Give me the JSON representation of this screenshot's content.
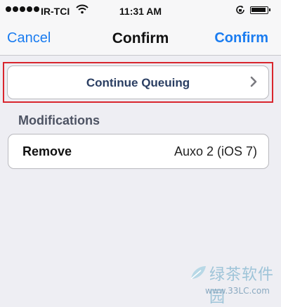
{
  "status_bar": {
    "carrier": "IR-TCI",
    "time": "11:31 AM",
    "signal_bars_filled": 5
  },
  "navbar": {
    "left_label": "Cancel",
    "title": "Confirm",
    "right_label": "Confirm"
  },
  "continue_row": {
    "label": "Continue Queuing"
  },
  "modifications": {
    "header": "Modifications",
    "rows": [
      {
        "action": "Remove",
        "value": "Auxo 2 (iOS 7)"
      }
    ]
  },
  "watermark": {
    "text": "绿茶软件园",
    "url": "www.33LC.com"
  },
  "colors": {
    "accent": "#1a7cf0",
    "highlight_border": "#d9262e",
    "background": "#eeeef3"
  },
  "icons": [
    "wifi-icon",
    "rotation-lock-icon",
    "battery-icon",
    "chevron-right-icon",
    "watermark-logo-icon"
  ]
}
